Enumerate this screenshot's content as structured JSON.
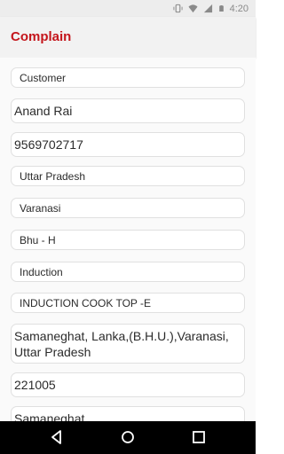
{
  "status_bar": {
    "time": "4:20",
    "icons": [
      "vibrate-icon",
      "wifi-icon",
      "signal-icon",
      "battery-icon"
    ]
  },
  "app_bar": {
    "title": "Complain"
  },
  "form": {
    "fields": [
      {
        "name": "customer-type",
        "value": "Customer"
      },
      {
        "name": "customer-name",
        "value": "Anand Rai"
      },
      {
        "name": "phone-number",
        "value": "9569702717"
      },
      {
        "name": "state",
        "value": "Uttar Pradesh"
      },
      {
        "name": "district",
        "value": "Varanasi"
      },
      {
        "name": "area",
        "value": "Bhu - H"
      },
      {
        "name": "product-category",
        "value": "Induction"
      },
      {
        "name": "product-model",
        "value": "INDUCTION COOK TOP -E"
      },
      {
        "name": "address",
        "value": "Samaneghat, Lanka,(B.H.U.),Varanasi, Uttar Pradesh"
      },
      {
        "name": "pincode",
        "value": "221005"
      },
      {
        "name": "landmark",
        "value": "Samaneghat"
      }
    ]
  },
  "colors": {
    "accent": "#c4161c",
    "status_bar": "#ededed",
    "nav_bar": "#000000"
  },
  "nav_bar": {
    "buttons": [
      "back-icon",
      "home-icon",
      "recents-icon"
    ]
  }
}
